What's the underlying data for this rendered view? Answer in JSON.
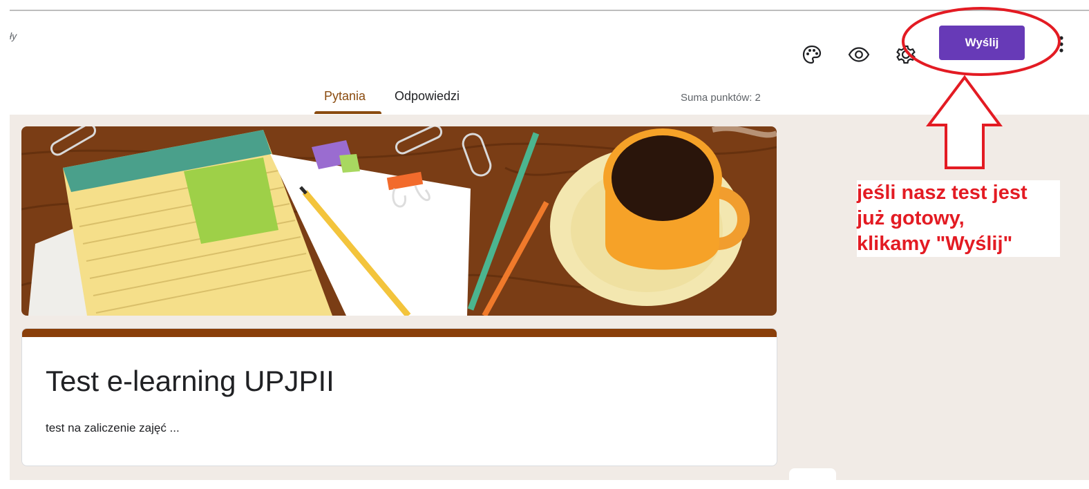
{
  "header": {
    "crumb_fragment": "ły",
    "send_label": "Wyślij",
    "tabs": [
      {
        "label": "Pytania",
        "active": true
      },
      {
        "label": "Odpowiedzi",
        "active": false
      }
    ],
    "points": "Suma punktów: 2",
    "icons": [
      "palette-icon",
      "eye-icon",
      "gear-icon",
      "more-vert-icon"
    ]
  },
  "form": {
    "title": "Test e-learning UPJPII",
    "description": "test na zaliczenie zajęć ..."
  },
  "annotation": {
    "line1": "jeśli nasz test jest",
    "line2": "już gotowy,",
    "line3": "klikamy \"Wyślij\"",
    "color": "#e31b23"
  },
  "colors": {
    "accent": "#673ab7",
    "theme": "#8a3f0a",
    "background": "#f1ebe6"
  }
}
